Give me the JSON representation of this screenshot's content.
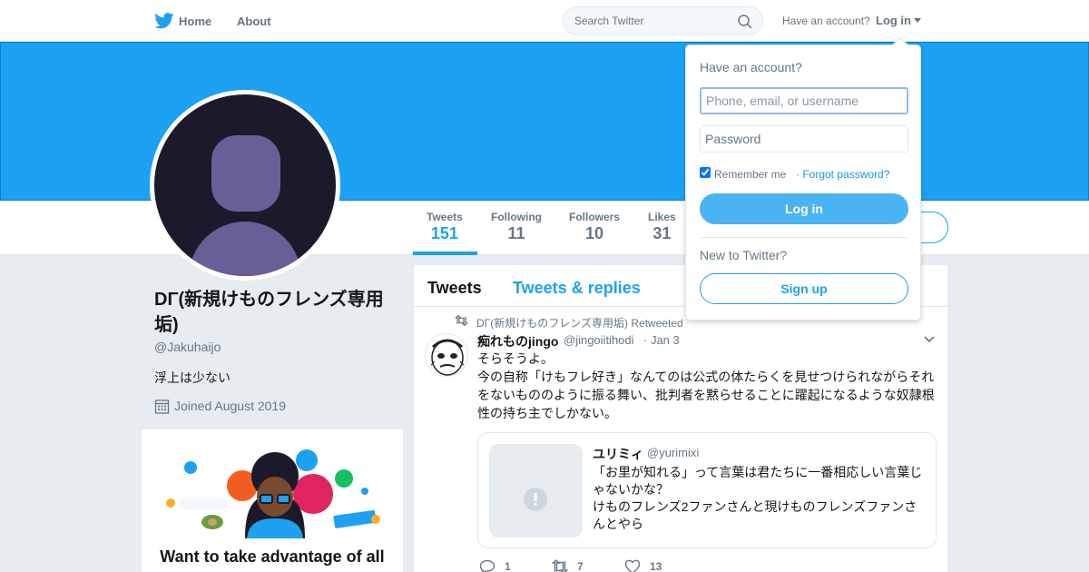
{
  "colors": {
    "brand": "#1da1f2",
    "banner": "#1da1f2",
    "avatar_bg": "#1c1a2a",
    "avatar_figure": "#6a5e96"
  },
  "nav": {
    "home": "Home",
    "about": "About",
    "search_placeholder": "Search Twitter",
    "have_account": "Have an account?",
    "login": "Log in"
  },
  "stats": [
    {
      "label": "Tweets",
      "value": "151"
    },
    {
      "label": "Following",
      "value": "11"
    },
    {
      "label": "Followers",
      "value": "10"
    },
    {
      "label": "Likes",
      "value": "31"
    }
  ],
  "profile": {
    "name": "DΓ(新規けものフレンズ専用垢)",
    "handle": "@Jakuhaijo",
    "bio": "浮上は少ない",
    "joined": "Joined August 2019"
  },
  "promo": {
    "title": "Want to take advantage of all"
  },
  "timeline": {
    "tabs": {
      "tweets": "Tweets",
      "replies": "Tweets & replies"
    },
    "tweet": {
      "retweeted_by": "DΓ(新規けものフレンズ専用垢) Retweeted",
      "author_name": "痴れものjingo",
      "author_handle": "@jingoiitihodi",
      "date": "· Jan 3",
      "text_lines": [
        "そらそうよ。",
        "今の自称「けもフレ好き」なんてのは公式の体たらくを見せつけられながらそれ",
        "をないもののように振る舞い、批判者を黙らせることに躍起になるような奴隷根",
        "性の持ち主でしかない。"
      ],
      "quote": {
        "name": "ユリミィ",
        "handle": "@yurimixi",
        "text_lines": [
          "「お里が知れる」って言葉は君たちに一番相応しい言葉じ",
          "ゃないかな？",
          "けものフレンズ2ファンさんと現けものフレンズファンさ",
          "んとやら"
        ]
      },
      "actions": {
        "reply_count": "1",
        "retweet_count": "7",
        "like_count": "13"
      }
    }
  },
  "login_dropdown": {
    "title": "Have an account?",
    "phone_placeholder": "Phone, email, or username",
    "password_placeholder": "Password",
    "remember": "Remember me",
    "forgot": "· Forgot password?",
    "login_button": "Log in",
    "new_to_twitter": "New to Twitter?",
    "signup_button": "Sign up"
  }
}
